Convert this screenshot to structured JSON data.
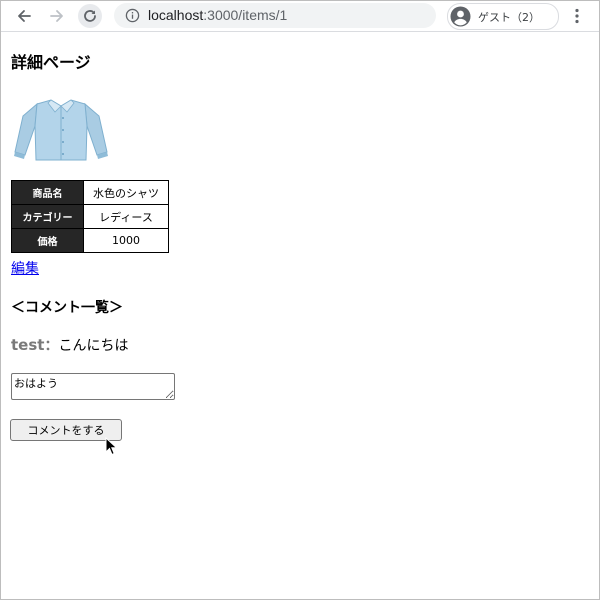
{
  "browser": {
    "url_host": "localhost",
    "url_path": ":3000/items/1",
    "profile_label": "ゲスト（2）",
    "icons": {
      "back": "arrow-left-icon",
      "forward": "arrow-right-icon",
      "reload": "reload-icon",
      "info": "info-circle-icon",
      "avatar": "account-circle-icon",
      "menu": "three-dots-vertical-icon"
    }
  },
  "page": {
    "title": "詳細ページ",
    "product_image": "shirt-image",
    "table": {
      "rows": [
        {
          "label": "商品名",
          "value": "水色のシャツ"
        },
        {
          "label": "カテゴリー",
          "value": "レディース"
        },
        {
          "label": "価格",
          "value": "1000"
        }
      ]
    },
    "edit_link": "編集",
    "comments_heading": "＜コメント一覧＞",
    "comments": [
      {
        "user": "test",
        "separator": "：",
        "text": "こんにちは"
      }
    ],
    "comment_input_value": "おはよう",
    "submit_label": "コメントをする"
  },
  "colors": {
    "link": "#0000ee",
    "table_header_bg": "#262626",
    "shirt": "#a9cce3"
  }
}
